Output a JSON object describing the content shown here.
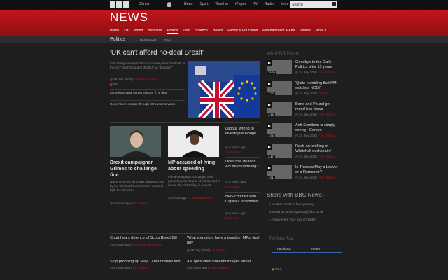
{
  "topbar": {
    "sign_in": "Sbnbo",
    "nav": [
      "News",
      "Sport",
      "Weather",
      "iPlayer",
      "TV",
      "Radio",
      "More"
    ],
    "search_placeholder": "Search"
  },
  "brand": {
    "title": "NEWS"
  },
  "mainnav": [
    "Home",
    "UK",
    "World",
    "Business",
    "Politics",
    "Tech",
    "Science",
    "Health",
    "Family & Education",
    "Entertainment & Arts",
    "Stories",
    "More ▾"
  ],
  "subnav": {
    "section": "Politics",
    "links": [
      "Parliaments",
      "Brexit"
    ]
  },
  "lead": {
    "headline": "'UK can't afford no-deal Brexit'",
    "summary": "Irish foreign minister Simon Coveney described talk of the UK \"crashing out of the EU\" as \"bravado\"",
    "date": "25 July 2018",
    "tag": "Northern Ireland",
    "comments": "450",
    "related1": "EU will demand 'border checks' if no deal",
    "related2": "Government scraps through EU customs votes"
  },
  "story2": {
    "title": "Brexit campaigner Grimes to challenge fine",
    "summary": "Darren Grimes, who was fined £20,000 by the Electoral Commission, wants to fight the decision",
    "time": "3 hours ago",
    "tag": "UK Politics"
  },
  "story3": {
    "title": "MP accused of lying about speeding",
    "summary": "Fiona Onasanya is charged with perverting the course of justice and is due at the Old Bailey in August",
    "time": "1 hour ago",
    "tag": "Cambridgeshire"
  },
  "story4": {
    "title": "Labour 'wrong to investigate Hodge'",
    "time": "6 hours ago",
    "tag": "UK Politics"
  },
  "story5": {
    "title": "Does the Treason Act need updating?",
    "time": "6 hours ago",
    "tag": "UK Politics"
  },
  "story6": {
    "title": "NHS contract with Capita a 'shambles'",
    "time": "6 hours ago",
    "tag": "Business"
  },
  "bottom": [
    {
      "title": "Court hears defence of Scots Brexit Bill",
      "time": "4 hours ago",
      "tag": "Scotland politics",
      "comments": "56"
    },
    {
      "title": "What you might have missed on MPs' final day",
      "time": "25 July 2018",
      "tag": "UK Politics"
    },
    {
      "title": "Stop propping up May, Labour rebels told",
      "time": "4 hours ago",
      "tag": "UK Politics"
    },
    {
      "title": "AM quits after indecent images arrest",
      "time": "6 hours ago",
      "tag": "Wales politics"
    }
  ],
  "watch": {
    "heading": "Watch/Listen",
    "items": [
      {
        "title": "Goodbye to the Daily Politics after 15 years",
        "date": "24 July 2018",
        "tag": "UK Politics",
        "duration": "15:35"
      },
      {
        "title": "'Quite humbling that PM watches NCIS'",
        "date": "24 July 2018",
        "tag": "Wales",
        "duration": "2:33"
      },
      {
        "title": "Bone and Pound get mood box views",
        "date": "24 July 2018",
        "tag": "UK Politics",
        "duration": "3:14"
      },
      {
        "title": "Anti-Semitism is simply wrong - Corbyn",
        "date": "24 July 2018",
        "tag": "UK Politics",
        "duration": "1:34"
      },
      {
        "title": "Raab on 'shifting of Whitehall deckchairs'",
        "date": "24 July 2018",
        "tag": "UK Politics",
        "duration": "2:17"
      },
      {
        "title": "Is Theresa May a Leaver or a Remainer?",
        "date": "24 July 2018",
        "tag": "UK Politics",
        "duration": "1:51"
      }
    ]
  },
  "share": {
    "heading": "Share with BBC News",
    "line1": "Send an email to haveyoursay",
    "line2": "Email us at haveyoursay@bbc.co.uk",
    "line3": "Follow Have Your Say on Twitter"
  },
  "follow": {
    "heading": "Follow Us",
    "facebook": "Facebook",
    "twitter": "Twitter",
    "rss": "RSS"
  }
}
